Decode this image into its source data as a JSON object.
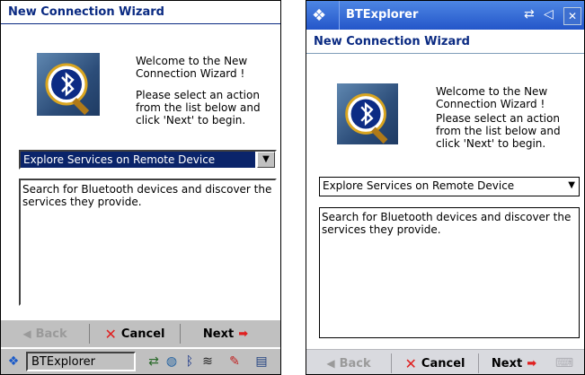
{
  "left": {
    "title": "New Connection Wizard",
    "welcome": "Welcome to the New\nConnection Wizard !",
    "instructions": "Please select an action\nfrom the list below and\nclick 'Next' to begin.",
    "action_selected": "Explore Services on Remote Device",
    "description": "Search for Bluetooth devices and discover the services they provide.",
    "back_label": "Back",
    "cancel_label": "Cancel",
    "next_label": "Next",
    "taskbar": {
      "app_label": "BTExplorer",
      "tray_icons": [
        "network-icon",
        "globe-icon",
        "bluetooth-icon",
        "signal-icon",
        "edit-icon",
        "window-icon"
      ]
    }
  },
  "right": {
    "app_title": "BTExplorer",
    "status_icons": [
      "connection-icon",
      "volume-icon",
      "close-icon"
    ],
    "title": "New Connection Wizard",
    "welcome": "Welcome to the New\nConnection Wizard !",
    "instructions": "Please select an action\nfrom the list below and\nclick 'Next' to begin.",
    "action_selected": "Explore Services on Remote Device",
    "description": "Search for Bluetooth devices and discover the services they provide.",
    "back_label": "Back",
    "cancel_label": "Cancel",
    "next_label": "Next"
  },
  "colors": {
    "title_text": "#0a2a82",
    "selection_bg": "#0a246a",
    "taskbar_bg": "#c0c0c0",
    "titlebar_blue": "#2f68d8",
    "next_arrow": "#e02020",
    "cancel_x": "#e02020"
  }
}
